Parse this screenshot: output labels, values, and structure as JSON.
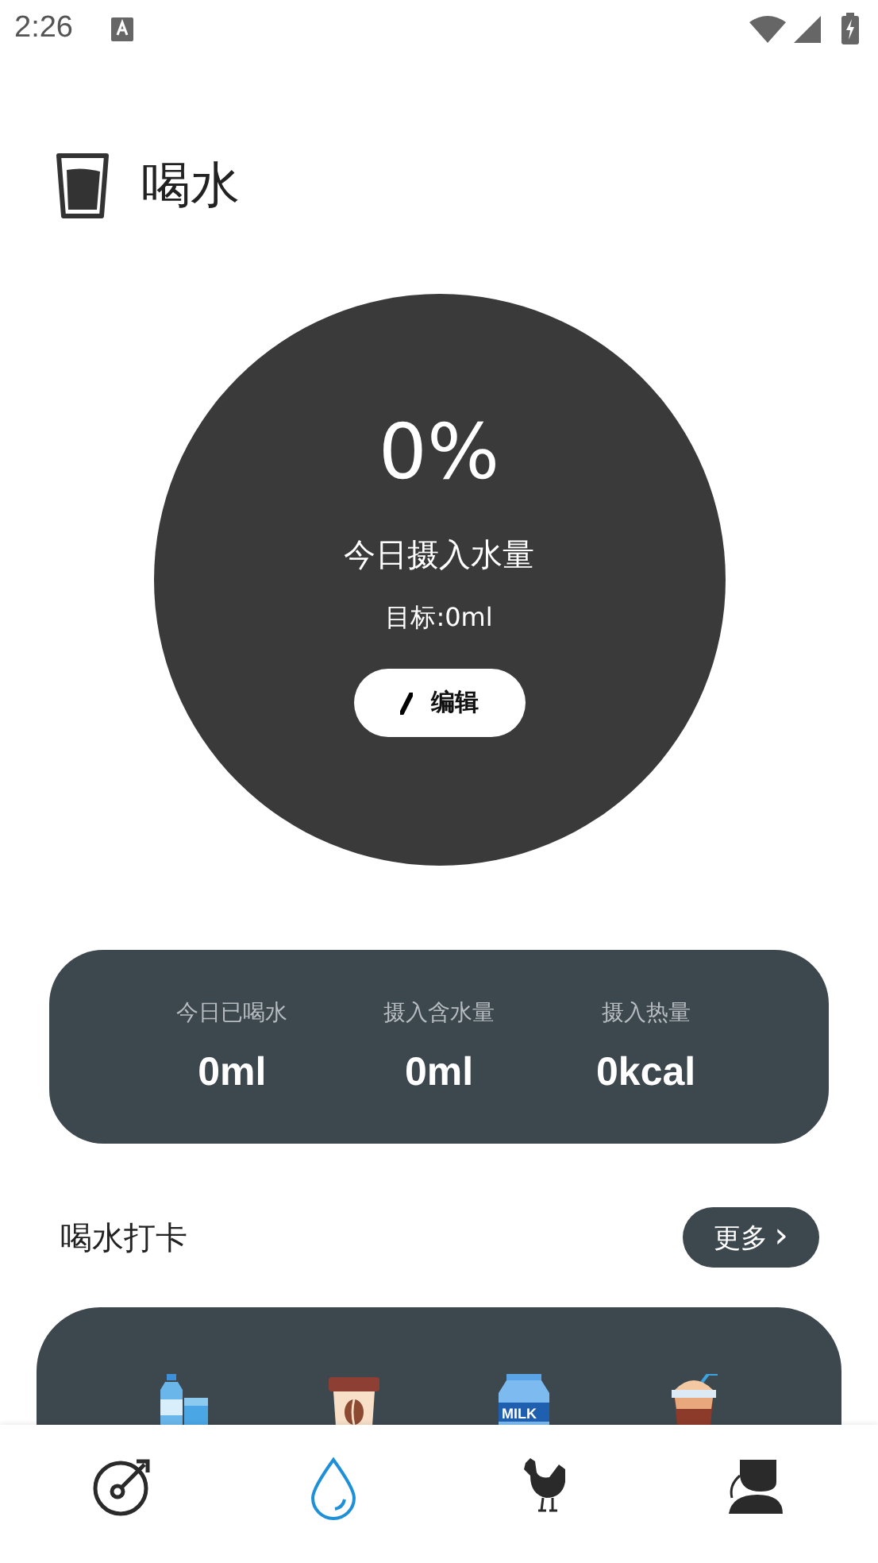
{
  "status_bar": {
    "time": "2:26"
  },
  "header": {
    "title": "喝水"
  },
  "progress": {
    "percent": "0%",
    "label": "今日摄入水量",
    "goal": "目标:0ml",
    "edit_button": "编辑"
  },
  "stats": [
    {
      "label": "今日已喝水",
      "value": "0ml"
    },
    {
      "label": "摄入含水量",
      "value": "0ml"
    },
    {
      "label": "摄入热量",
      "value": "0kcal"
    }
  ],
  "checkin": {
    "title": "喝水打卡",
    "more_button": "更多",
    "more_arrow": "›"
  },
  "drinks": [
    {
      "kind": "water"
    },
    {
      "kind": "coffee"
    },
    {
      "kind": "milk",
      "label": "MILK"
    },
    {
      "kind": "smoothie"
    }
  ],
  "nav": [
    {
      "kind": "dial",
      "selected": false
    },
    {
      "kind": "drop",
      "selected": true
    },
    {
      "kind": "chicken",
      "selected": false
    },
    {
      "kind": "person",
      "selected": false
    }
  ]
}
